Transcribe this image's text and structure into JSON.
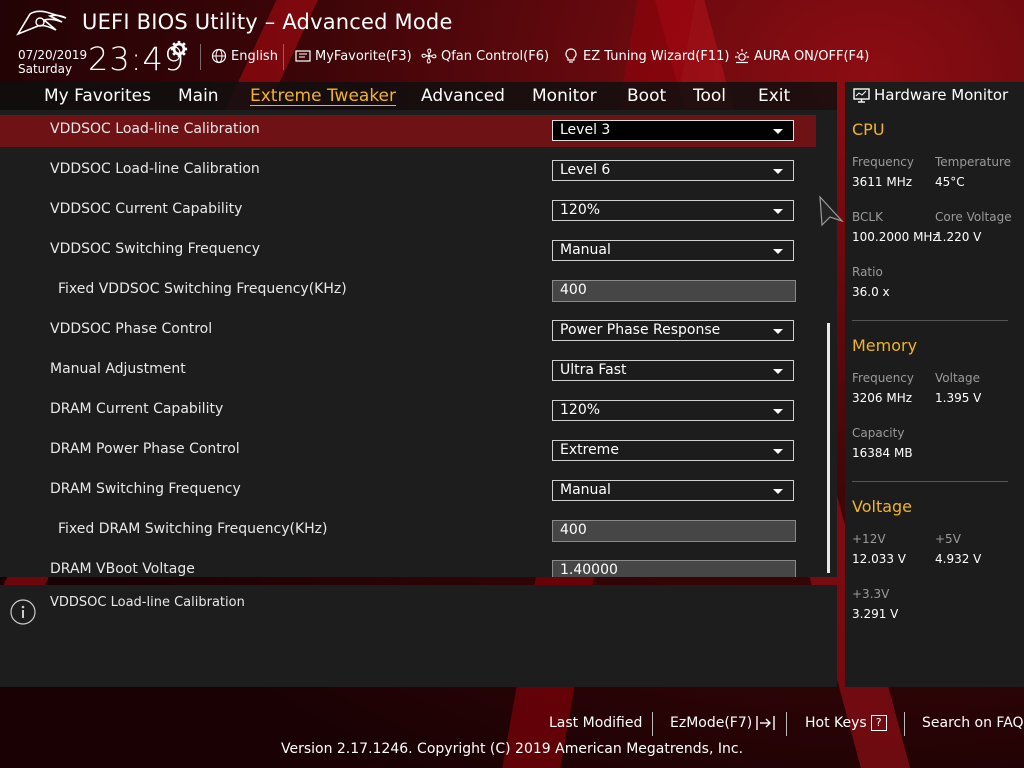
{
  "header": {
    "title": "UEFI BIOS Utility – Advanced Mode",
    "date": "07/20/2019",
    "day": "Saturday",
    "time": "23:49",
    "items": [
      {
        "label": "English",
        "icon": "globe-icon"
      },
      {
        "label": "MyFavorite(F3)",
        "icon": "favorite-icon"
      },
      {
        "label": "Qfan Control(F6)",
        "icon": "fan-icon"
      },
      {
        "label": "EZ Tuning Wizard(F11)",
        "icon": "lightbulb-icon"
      },
      {
        "label": "AURA ON/OFF(F4)",
        "icon": "aura-icon"
      }
    ]
  },
  "tabs": [
    {
      "label": "My Favorites"
    },
    {
      "label": "Main"
    },
    {
      "label": "Extreme Tweaker",
      "active": true
    },
    {
      "label": "Advanced"
    },
    {
      "label": "Monitor"
    },
    {
      "label": "Boot"
    },
    {
      "label": "Tool"
    },
    {
      "label": "Exit"
    }
  ],
  "settings": [
    {
      "label": "VDDSOC Load-line Calibration",
      "value": "Level 3",
      "kind": "select",
      "selected": true
    },
    {
      "label": "VDDSOC Load-line Calibration",
      "value": "Level 6",
      "kind": "select"
    },
    {
      "label": "VDDSOC Current Capability",
      "value": "120%",
      "kind": "select"
    },
    {
      "label": "VDDSOC Switching Frequency",
      "value": "Manual",
      "kind": "select"
    },
    {
      "label": "Fixed VDDSOC Switching Frequency(KHz)",
      "value": "400",
      "kind": "field",
      "sub": true
    },
    {
      "label": "VDDSOC Phase Control",
      "value": "Power Phase Response",
      "kind": "select"
    },
    {
      "label": "Manual Adjustment",
      "value": "Ultra Fast",
      "kind": "select"
    },
    {
      "label": "DRAM Current Capability",
      "value": "120%",
      "kind": "select"
    },
    {
      "label": "DRAM Power Phase Control",
      "value": "Extreme",
      "kind": "select"
    },
    {
      "label": "DRAM Switching Frequency",
      "value": "Manual",
      "kind": "select"
    },
    {
      "label": "Fixed DRAM Switching Frequency(KHz)",
      "value": "400",
      "kind": "field",
      "sub": true
    },
    {
      "label": "DRAM VBoot Voltage",
      "value": "1.40000",
      "kind": "field"
    }
  ],
  "description": "VDDSOC Load-line Calibration",
  "hardware_monitor": {
    "title": "Hardware Monitor",
    "cpu": {
      "title": "CPU",
      "frequency_label": "Frequency",
      "frequency": "3611 MHz",
      "temperature_label": "Temperature",
      "temperature": "45°C",
      "bclk_label": "BCLK",
      "bclk": "100.2000 MHz",
      "core_voltage_label": "Core Voltage",
      "core_voltage": "1.220 V",
      "ratio_label": "Ratio",
      "ratio": "36.0 x"
    },
    "memory": {
      "title": "Memory",
      "frequency_label": "Frequency",
      "frequency": "3206 MHz",
      "voltage_label": "Voltage",
      "voltage": "1.395 V",
      "capacity_label": "Capacity",
      "capacity": "16384 MB"
    },
    "voltage": {
      "title": "Voltage",
      "v12_label": "+12V",
      "v12": "12.033 V",
      "v5_label": "+5V",
      "v5": "4.932 V",
      "v33_label": "+3.3V",
      "v33": "3.291 V"
    }
  },
  "footer": {
    "last_modified": "Last Modified",
    "ezmode": "EzMode(F7)",
    "hot_keys": "Hot Keys",
    "hot_keys_icon": "?",
    "search_faq": "Search on FAQ",
    "version": "Version 2.17.1246. Copyright (C) 2019 American Megatrends, Inc."
  },
  "colors": {
    "accent": "#f0b428",
    "selected_row": "#6e1216",
    "panel": "#1d1d1d"
  }
}
